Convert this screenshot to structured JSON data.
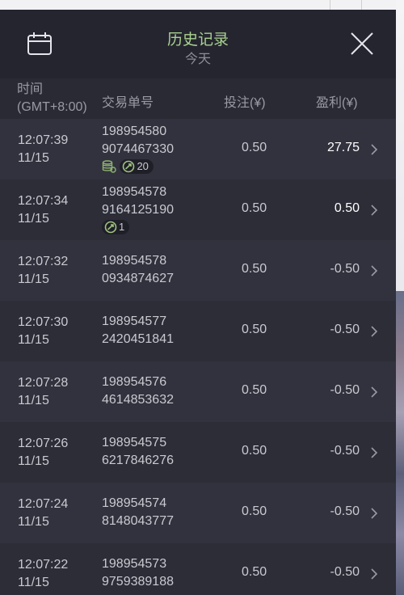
{
  "header": {
    "title": "历史记录",
    "subtitle": "今天",
    "calendar_icon": "calendar-icon",
    "close_icon": "close-icon"
  },
  "columns": {
    "time_label_1": "时间",
    "time_label_2": "(GMT+8:00)",
    "order": "交易单号",
    "bet": "投注(¥)",
    "profit": "盈利(¥)"
  },
  "rows": [
    {
      "time": "12:07:39",
      "date": "11/15",
      "order1": "198954580",
      "order2": "9074467330",
      "bet": "0.50",
      "profit": "27.75",
      "coin_icon": true,
      "badge": "20"
    },
    {
      "time": "12:07:34",
      "date": "11/15",
      "order1": "198954578",
      "order2": "9164125190",
      "bet": "0.50",
      "profit": "0.50",
      "badge": "1"
    },
    {
      "time": "12:07:32",
      "date": "11/15",
      "order1": "198954578",
      "order2": "0934874627",
      "bet": "0.50",
      "profit": "-0.50"
    },
    {
      "time": "12:07:30",
      "date": "11/15",
      "order1": "198954577",
      "order2": "2420451841",
      "bet": "0.50",
      "profit": "-0.50"
    },
    {
      "time": "12:07:28",
      "date": "11/15",
      "order1": "198954576",
      "order2": "4614853632",
      "bet": "0.50",
      "profit": "-0.50"
    },
    {
      "time": "12:07:26",
      "date": "11/15",
      "order1": "198954575",
      "order2": "6217846276",
      "bet": "0.50",
      "profit": "-0.50"
    },
    {
      "time": "12:07:24",
      "date": "11/15",
      "order1": "198954574",
      "order2": "8148043777",
      "bet": "0.50",
      "profit": "-0.50"
    },
    {
      "time": "12:07:22",
      "date": "11/15",
      "order1": "198954573",
      "order2": "9759389188",
      "bet": "0.50",
      "profit": "-0.50"
    }
  ],
  "colors": {
    "title": "#a9d18e",
    "panel": "#2d2d38",
    "header": "#252530",
    "row_alt": "#32323e"
  }
}
